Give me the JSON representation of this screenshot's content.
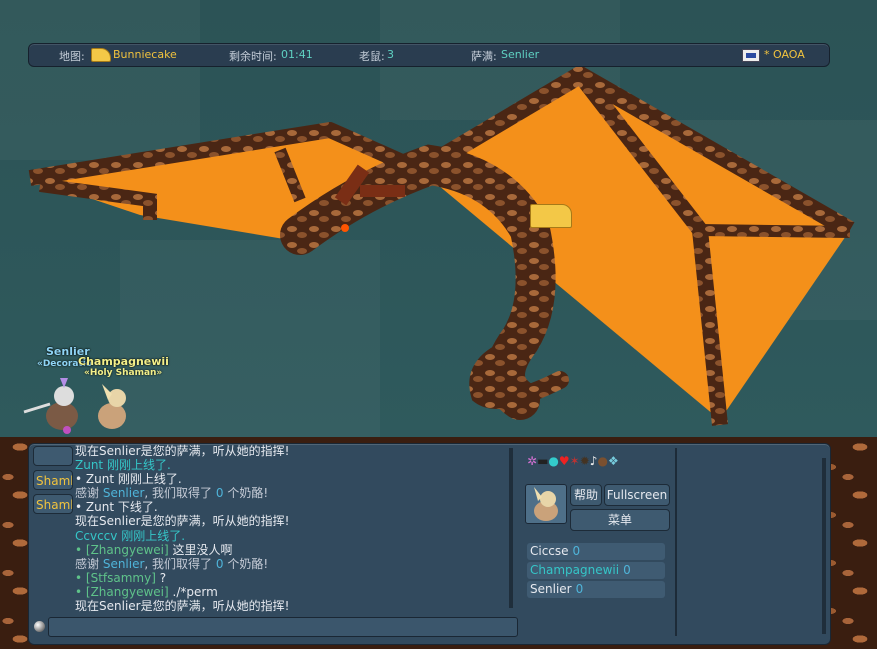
{
  "topbar": {
    "map_label": "地图:",
    "map_name": "Bunniecake",
    "time_label": "剩余时间:",
    "time_value": "01:41",
    "mice_label": "老鼠:",
    "mice_value": "3",
    "shaman_label": "萨满:",
    "shaman_value": "Senlier",
    "room": "* OAOA"
  },
  "players_on_map": [
    {
      "name": "Senlier",
      "title": "«Decoratio"
    },
    {
      "name": "Champagnewii",
      "title": "«Holy Shaman»"
    }
  ],
  "tabs": [
    "",
    "Shamb",
    "Shamb"
  ],
  "chat": [
    [
      {
        "t": "现在Senlier是您的萨满，听从她的指挥!",
        "c": "c-white"
      }
    ],
    [
      {
        "t": "Zunt 刚刚上线了.",
        "c": "c-cyan"
      }
    ],
    [
      {
        "t": "• Zunt 刚刚上线了.",
        "c": "c-white"
      }
    ],
    [
      {
        "t": "感谢 ",
        "c": ""
      },
      {
        "t": "Senlier",
        "c": "c-name"
      },
      {
        "t": ", 我们取得了 ",
        "c": ""
      },
      {
        "t": "0",
        "c": "c-num"
      },
      {
        "t": " 个奶酪!",
        "c": ""
      }
    ],
    [
      {
        "t": "• Zunt 下线了.",
        "c": "c-white"
      }
    ],
    [
      {
        "t": "现在Senlier是您的萨满，听从她的指挥!",
        "c": "c-white"
      }
    ],
    [
      {
        "t": "Ccvccv 刚刚上线了.",
        "c": "c-cyan"
      }
    ],
    [
      {
        "t": "• ",
        "c": "c-green"
      },
      {
        "t": "[Zhangyewei]",
        "c": "c-green"
      },
      {
        "t": " 这里没人啊",
        "c": "c-white"
      }
    ],
    [
      {
        "t": "感谢 ",
        "c": ""
      },
      {
        "t": "Senlier",
        "c": "c-name"
      },
      {
        "t": ", 我们取得了 ",
        "c": ""
      },
      {
        "t": "0",
        "c": "c-num"
      },
      {
        "t": " 个奶酪!",
        "c": ""
      }
    ],
    [
      {
        "t": "• ",
        "c": "c-green"
      },
      {
        "t": "[Stfsammy]",
        "c": "c-green"
      },
      {
        "t": " ?",
        "c": "c-white"
      }
    ],
    [
      {
        "t": "• ",
        "c": "c-green"
      },
      {
        "t": "[Zhangyewei]",
        "c": "c-green"
      },
      {
        "t": " ./*perm",
        "c": "c-white"
      }
    ],
    [
      {
        "t": "现在Senlier是您的萨满，听从她的指挥!",
        "c": "c-white"
      }
    ]
  ],
  "buttons": {
    "help": "帮助",
    "fullscreen": "Fullscreen",
    "menu": "菜单"
  },
  "player_list": [
    {
      "name": "Ciccse",
      "score": "0",
      "color": "#e6e9ef"
    },
    {
      "name": "Champagnewii",
      "score": "0",
      "color": "#35c6c8"
    },
    {
      "name": "Senlier",
      "score": "0",
      "color": "#e6e9ef"
    }
  ],
  "colors": {
    "accent": "#f1c33e",
    "teal": "#5fd1c2",
    "wing": "#f4901a"
  }
}
